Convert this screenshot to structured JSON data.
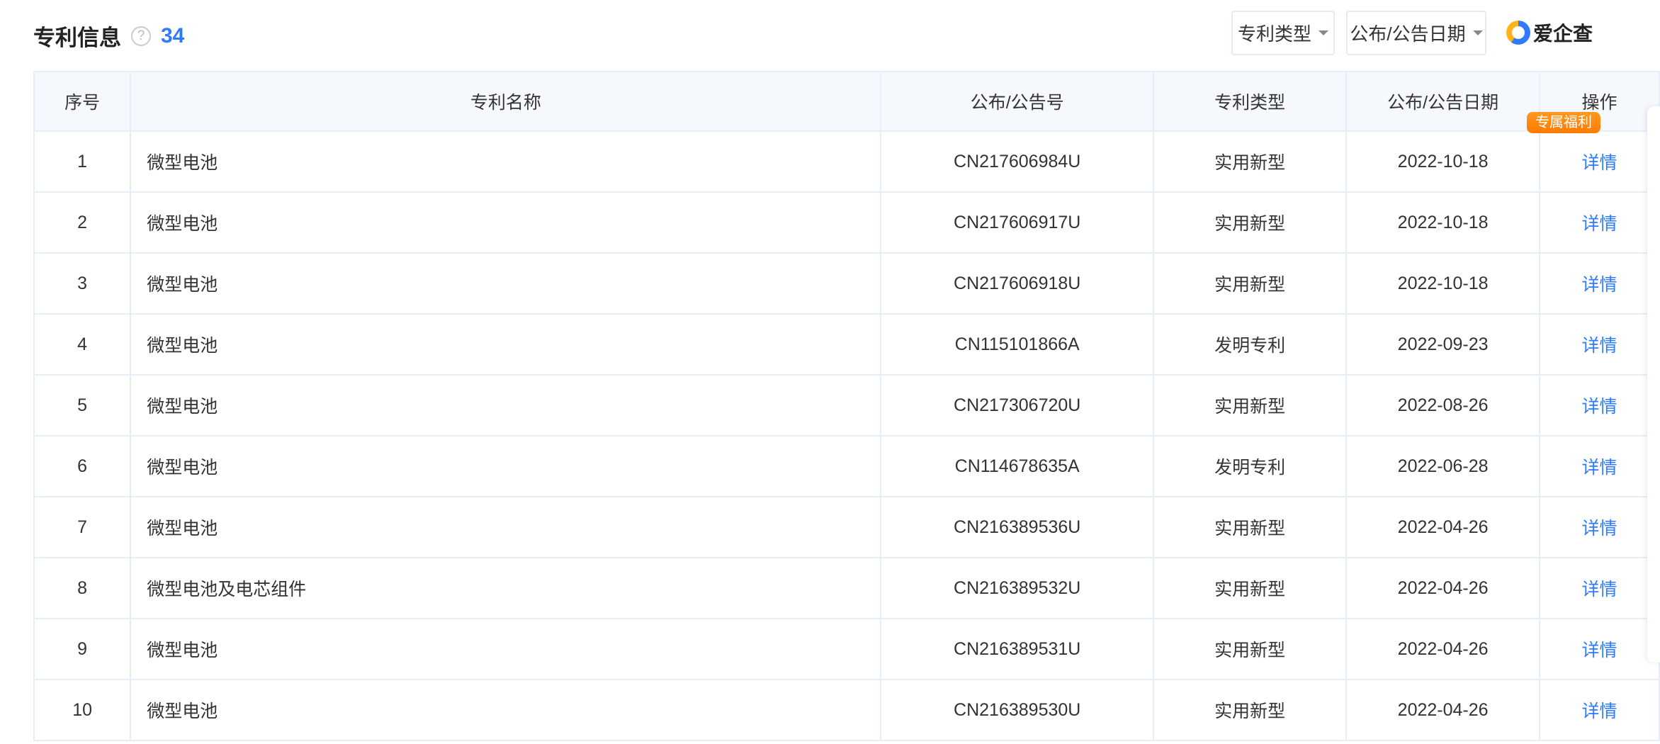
{
  "header": {
    "title": "专利信息",
    "help": "?",
    "count": "34"
  },
  "filters": {
    "type_label": "专利类型",
    "date_label": "公布/公告日期"
  },
  "logo": {
    "text": "爱企查"
  },
  "table": {
    "columns": [
      "序号",
      "专利名称",
      "公布/公告号",
      "专利类型",
      "公布/公告日期",
      "操作"
    ],
    "rows": [
      {
        "no": "1",
        "name": "微型电池",
        "pub": "CN217606984U",
        "type": "实用新型",
        "date": "2022-10-18",
        "op": "详情"
      },
      {
        "no": "2",
        "name": "微型电池",
        "pub": "CN217606917U",
        "type": "实用新型",
        "date": "2022-10-18",
        "op": "详情"
      },
      {
        "no": "3",
        "name": "微型电池",
        "pub": "CN217606918U",
        "type": "实用新型",
        "date": "2022-10-18",
        "op": "详情"
      },
      {
        "no": "4",
        "name": "微型电池",
        "pub": "CN115101866A",
        "type": "发明专利",
        "date": "2022-09-23",
        "op": "详情"
      },
      {
        "no": "5",
        "name": "微型电池",
        "pub": "CN217306720U",
        "type": "实用新型",
        "date": "2022-08-26",
        "op": "详情"
      },
      {
        "no": "6",
        "name": "微型电池",
        "pub": "CN114678635A",
        "type": "发明专利",
        "date": "2022-06-28",
        "op": "详情"
      },
      {
        "no": "7",
        "name": "微型电池",
        "pub": "CN216389536U",
        "type": "实用新型",
        "date": "2022-04-26",
        "op": "详情"
      },
      {
        "no": "8",
        "name": "微型电池及电芯组件",
        "pub": "CN216389532U",
        "type": "实用新型",
        "date": "2022-04-26",
        "op": "详情"
      },
      {
        "no": "9",
        "name": "微型电池",
        "pub": "CN216389531U",
        "type": "实用新型",
        "date": "2022-04-26",
        "op": "详情"
      },
      {
        "no": "10",
        "name": "微型电池",
        "pub": "CN216389530U",
        "type": "实用新型",
        "date": "2022-04-26",
        "op": "详情"
      }
    ]
  },
  "promo": {
    "badge": "专属福利"
  }
}
